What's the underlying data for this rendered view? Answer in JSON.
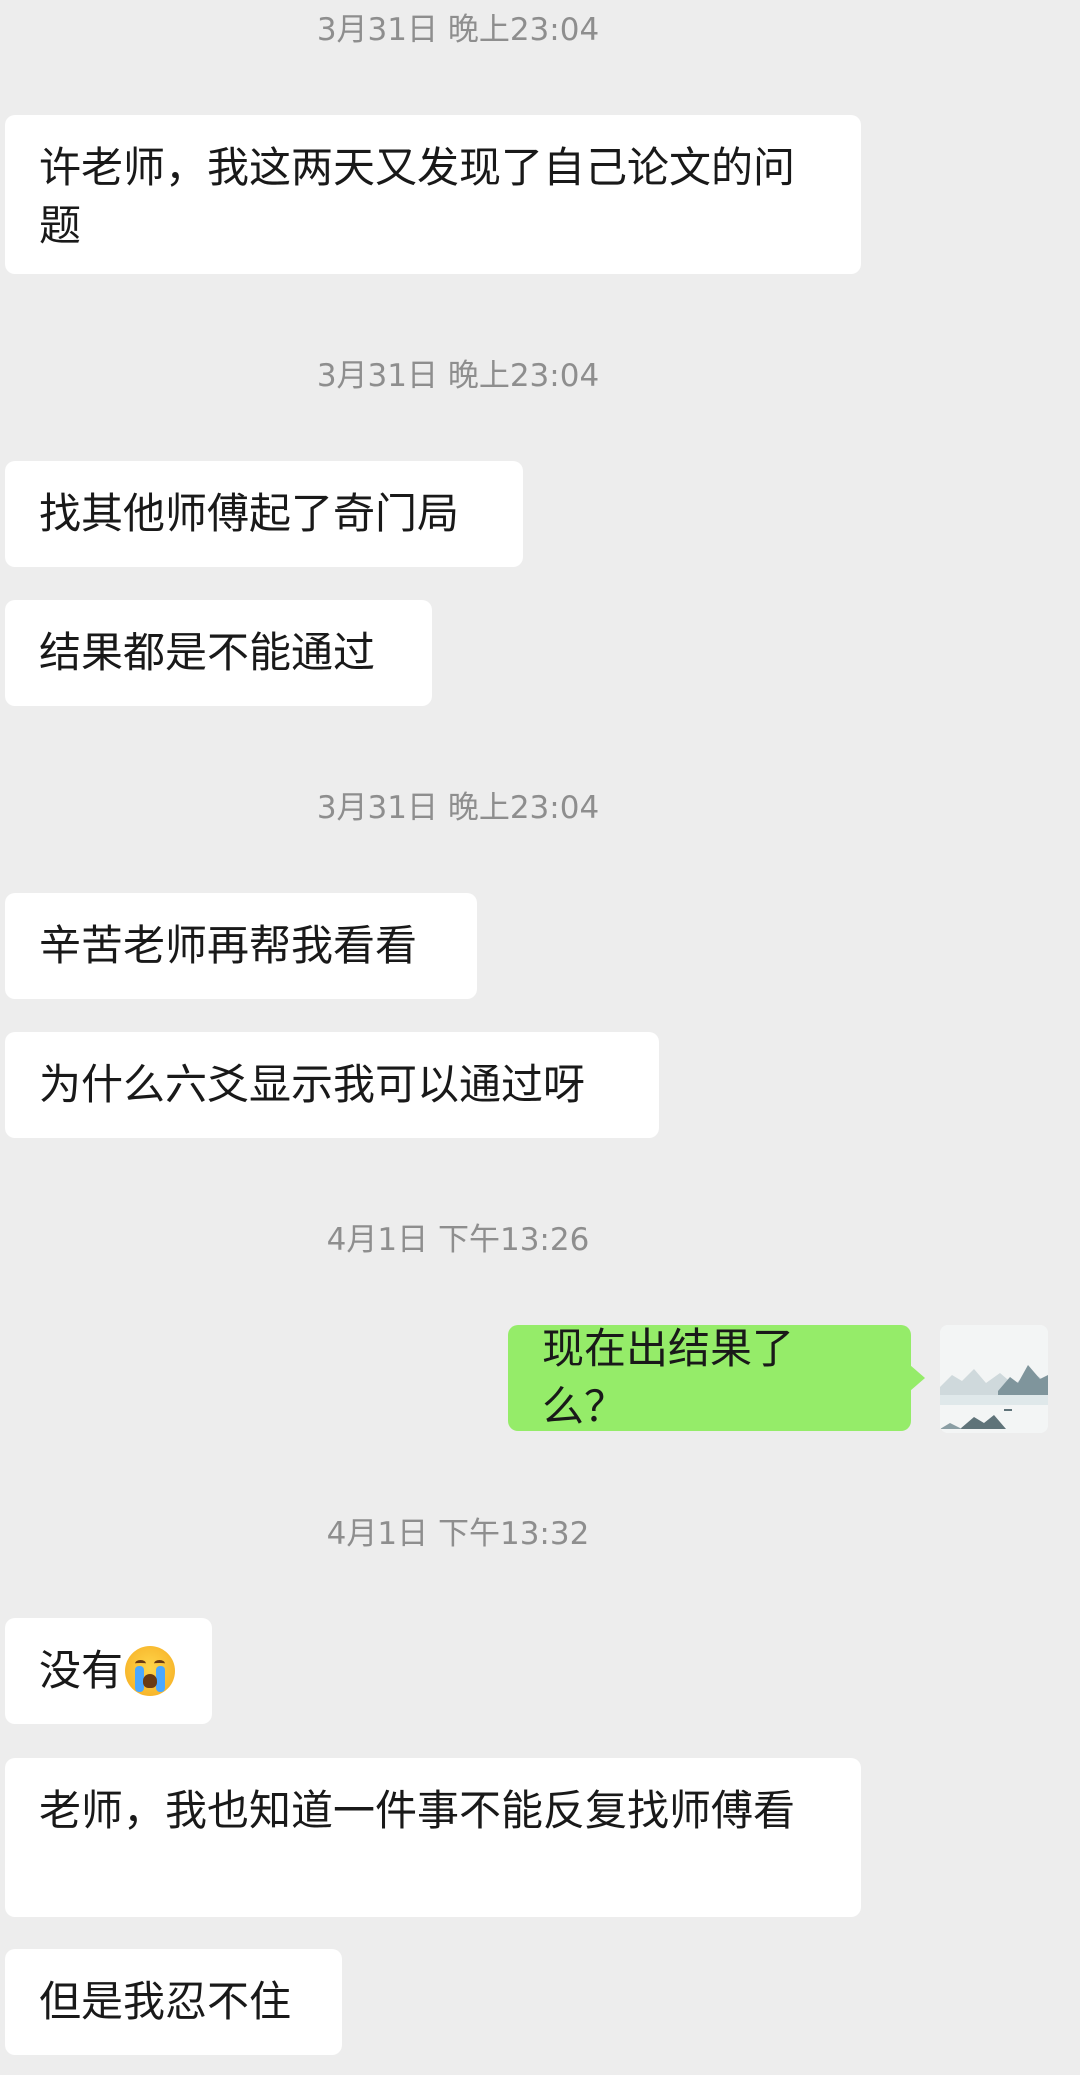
{
  "messages": [
    {
      "type": "timestamp",
      "text": "3月31日 晚上23:04"
    },
    {
      "type": "received",
      "text": "许老师，我这两天又发现了自己论文的问题"
    },
    {
      "type": "timestamp",
      "text": "3月31日 晚上23:04"
    },
    {
      "type": "received",
      "text": "找其他师傅起了奇门局"
    },
    {
      "type": "received",
      "text": "结果都是不能通过"
    },
    {
      "type": "timestamp",
      "text": "3月31日 晚上23:04"
    },
    {
      "type": "received",
      "text": "辛苦老师再帮我看看"
    },
    {
      "type": "received",
      "text": "为什么六爻显示我可以通过呀"
    },
    {
      "type": "timestamp",
      "text": "4月1日 下午13:26"
    },
    {
      "type": "sent",
      "text": "现在出结果了么？"
    },
    {
      "type": "timestamp",
      "text": "4月1日 下午13:32"
    },
    {
      "type": "received",
      "text": "没有",
      "emoji": "loudly-crying-face-icon"
    },
    {
      "type": "received",
      "text": "老师，我也知道一件事不能反复找师傅看"
    },
    {
      "type": "received",
      "text": "但是我忍不住"
    }
  ],
  "avatar": {
    "icon": "landscape-avatar-icon"
  },
  "colors": {
    "background": "#ededed",
    "received_bubble": "#ffffff",
    "sent_bubble": "#95ec69",
    "timestamp": "#8e8e8e"
  }
}
